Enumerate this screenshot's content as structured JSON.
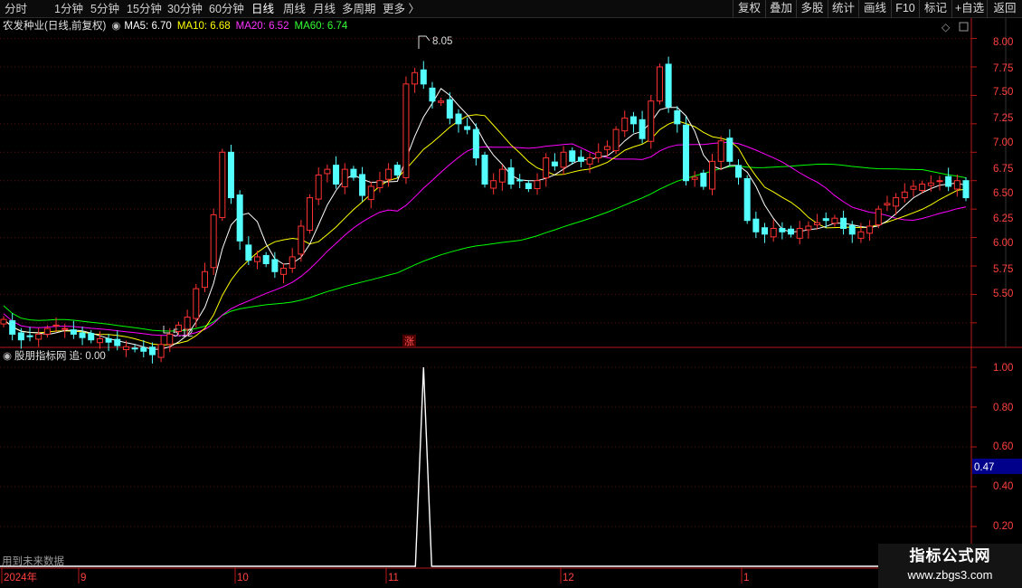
{
  "toolbar": {
    "timeframes": [
      "分时",
      "1分钟",
      "5分钟",
      "15分钟",
      "30分钟",
      "60分钟",
      "日线",
      "周线",
      "月线",
      "多周期",
      "更多 〉"
    ],
    "active": "日线",
    "right_buttons": [
      "复权",
      "叠加",
      "多股",
      "统计",
      "画线",
      "F10",
      "标记",
      "+自选",
      "返回"
    ]
  },
  "main_legend": {
    "title": "农发种业(日线,前复权)",
    "ma5": "MA5: 6.70",
    "ma10": "MA10: 6.68",
    "ma20": "MA20: 6.52",
    "ma60": "MA60: 6.74"
  },
  "sub_legend": {
    "title": "股朋指标网",
    "value": "追: 0.00"
  },
  "annotations": {
    "high_label": "8.05",
    "low_label": "5.12",
    "zhang_marker": "涨",
    "future_data_note": "用到未来数据"
  },
  "x_axis": {
    "labels": [
      "2024年",
      "9",
      "10",
      "11",
      "12",
      "1"
    ]
  },
  "price_axis": {
    "ticks": [
      "8.00",
      "7.75",
      "7.50",
      "7.25",
      "7.00",
      "6.75",
      "6.50",
      "6.25",
      "6.00",
      "5.75",
      "5.50"
    ]
  },
  "indicator_axis": {
    "ticks": [
      "1.00",
      "0.80",
      "0.60",
      "0.40",
      "0.20"
    ],
    "current_value": "0.47"
  },
  "watermark": {
    "title": "指标公式网",
    "url": "www.zbgs3.com"
  },
  "colors": {
    "up": "#ff3232",
    "down": "#54ffff",
    "ma5": "#ffffff",
    "ma10": "#ffff00",
    "ma20": "#ff00ff",
    "ma60": "#00ff00",
    "axis_border": "#b81818",
    "value_box": "#00008b"
  },
  "chart_data": [
    {
      "type": "candlestick",
      "title": "农发种业(日线,前复权)",
      "ylim": [
        5.3,
        8.1
      ],
      "x_range": [
        "2024-08",
        "2025-01"
      ],
      "series": [
        {
          "name": "MA5",
          "value": 6.7
        },
        {
          "name": "MA10",
          "value": 6.68
        },
        {
          "name": "MA20",
          "value": 6.52
        },
        {
          "name": "MA60",
          "value": 6.74
        }
      ],
      "annotations": [
        {
          "label": "8.05",
          "kind": "high"
        },
        {
          "label": "5.12",
          "kind": "low"
        }
      ],
      "closes": [
        5.53,
        5.4,
        5.35,
        5.38,
        5.4,
        5.45,
        5.48,
        5.45,
        5.4,
        5.37,
        5.35,
        5.36,
        5.33,
        5.3,
        5.29,
        5.27,
        5.25,
        5.22,
        5.31,
        5.4,
        5.48,
        5.55,
        5.8,
        5.95,
        6.45,
        7.0,
        6.6,
        6.22,
        6.05,
        6.08,
        6.02,
        5.95,
        5.98,
        6.08,
        6.35,
        6.6,
        6.8,
        6.85,
        6.72,
        6.85,
        6.78,
        6.62,
        6.7,
        6.75,
        6.85,
        6.8,
        7.6,
        7.7,
        7.6,
        7.45,
        7.45,
        7.3,
        7.25,
        7.2,
        6.95,
        6.72,
        6.75,
        6.85,
        6.72,
        6.75,
        6.68,
        6.75,
        6.95,
        6.88,
        7.0,
        6.92,
        6.92,
        6.95,
        7.0,
        7.05,
        7.2,
        7.3,
        7.25,
        7.12,
        7.45,
        7.75,
        7.4,
        7.25,
        6.75,
        6.78,
        6.7,
        6.92,
        7.1,
        6.92,
        6.78,
        6.4,
        6.3,
        6.28,
        6.33,
        6.3,
        6.28,
        6.33,
        6.35,
        6.38,
        6.4,
        6.42,
        6.33,
        6.28,
        6.3,
        6.35,
        6.5,
        6.55,
        6.6,
        6.65,
        6.7,
        6.72,
        6.73,
        6.75,
        6.7,
        6.75,
        6.6
      ]
    },
    {
      "type": "line",
      "title": "股朋指标网",
      "series": [
        {
          "name": "追",
          "value": 0.0
        }
      ],
      "ylim": [
        0,
        1.0
      ],
      "y_ticks": [
        1.0,
        0.8,
        0.6,
        0.4,
        0.2
      ],
      "current_value": 0.47,
      "signals": [
        {
          "bar_index": 48,
          "value": 1.0
        }
      ]
    }
  ]
}
